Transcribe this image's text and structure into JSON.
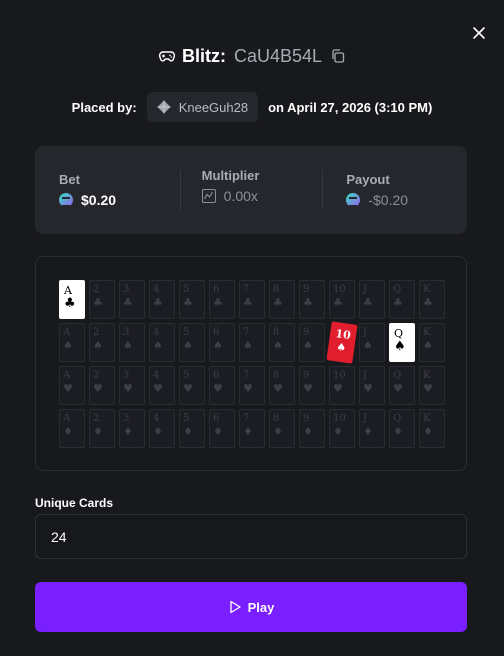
{
  "header": {
    "game_name": "Blitz:",
    "bet_id": "CaU4B54L"
  },
  "placed": {
    "label": "Placed by:",
    "username": "KneeGuh28",
    "date_text": "on April 27, 2026 (3:10 PM)"
  },
  "stats": {
    "bet_label": "Bet",
    "bet_value": "$0.20",
    "multiplier_label": "Multiplier",
    "multiplier_value": "0.00x",
    "payout_label": "Payout",
    "payout_value": "-$0.20"
  },
  "board": {
    "ranks": [
      "A",
      "2",
      "3",
      "4",
      "5",
      "6",
      "7",
      "8",
      "9",
      "10",
      "J",
      "Q",
      "K"
    ],
    "suits": [
      "♣",
      "♠",
      "♥",
      "♦"
    ],
    "highlighted": [
      {
        "row": 0,
        "col": 0,
        "style": "white"
      },
      {
        "row": 1,
        "col": 9,
        "style": "red"
      },
      {
        "row": 1,
        "col": 11,
        "style": "white"
      }
    ]
  },
  "unique_cards": {
    "label": "Unique Cards",
    "value": "24"
  },
  "play_button": {
    "label": "Play"
  },
  "colors": {
    "background": "#18191d",
    "panel": "#25272d",
    "accent": "#7a1fff",
    "highlight_red": "#e01e2e"
  },
  "icons": {
    "close": "close-icon",
    "game": "gamepad-icon",
    "copy": "copy-icon",
    "user": "diamond-icon",
    "coin": "coin-icon",
    "multiplier": "chart-icon",
    "play": "play-icon"
  }
}
